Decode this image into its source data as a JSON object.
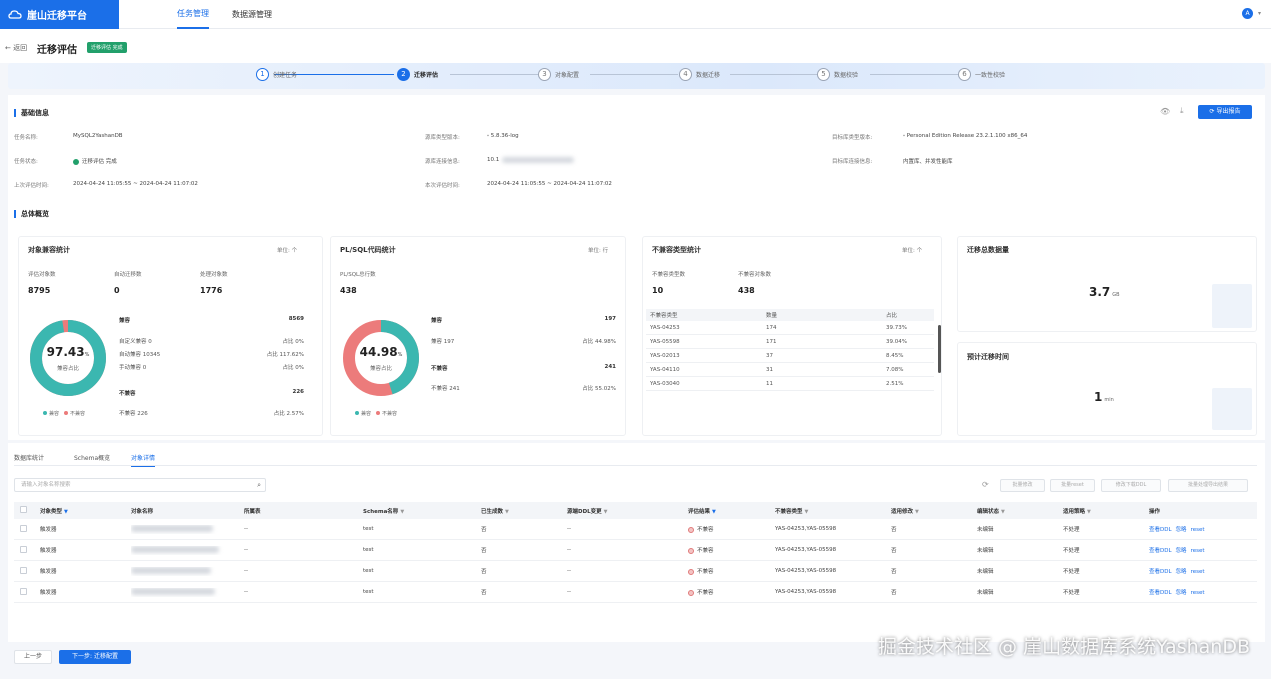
{
  "app": {
    "logo_text": "崖山迁移平台",
    "nav": [
      {
        "label": "任务管理",
        "active": true
      },
      {
        "label": "数据源管理",
        "active": false
      }
    ],
    "user_initial": "A"
  },
  "page": {
    "back_label": "← 返回",
    "title": "迁移评估",
    "badge": "迁移评估 完成"
  },
  "steps": [
    {
      "num": "1",
      "label": "创建任务"
    },
    {
      "num": "2",
      "label": "迁移评估"
    },
    {
      "num": "3",
      "label": "对象配置"
    },
    {
      "num": "4",
      "label": "数据迁移"
    },
    {
      "num": "5",
      "label": "数据校验"
    },
    {
      "num": "6",
      "label": "一致性校验"
    }
  ],
  "basic": {
    "section_title": "基础信息",
    "report_button": "导出报告",
    "task_name_label": "任务名称:",
    "task_name": "MySQL2YashanDB",
    "task_status_label": "任务状态:",
    "task_status": "迁移评估 完成",
    "last_eval_label": "上次评估时间:",
    "last_eval": "2024-04-24 11:05:55 ~ 2024-04-24 11:07:02",
    "src_version_label": "源库类型版本:",
    "src_version": "5.8.36-log",
    "src_conn_label": "源库连接信息:",
    "src_conn": "10.1",
    "this_eval_label": "本次评估时间:",
    "this_eval": "2024-04-24 11:05:55 ~ 2024-04-24 11:07:02",
    "tgt_version_label": "目标库类型版本:",
    "tgt_version": "Personal Edition Release 23.2.1.100 x86_64",
    "tgt_conn_label": "目标库连接信息:",
    "tgt_conn": "内置库、并发性能库"
  },
  "overview": {
    "section_title": "总体概览",
    "obj": {
      "title": "对象兼容统计",
      "unit": "单位: 个",
      "stats": [
        {
          "label": "评估对象数",
          "value": "8795"
        },
        {
          "label": "自动迁移数",
          "value": "0"
        },
        {
          "label": "处理对象数",
          "value": "1776"
        }
      ],
      "percent_int": "97.43",
      "percent_suffix": "%",
      "center_label": "兼容占比",
      "compat_label": "兼容",
      "compat_value": "8569",
      "rows": [
        {
          "l": "自定义兼容 0",
          "r": "占比 0%"
        },
        {
          "l": "自动兼容 10345",
          "r": "占比 117.62%"
        },
        {
          "l": "手动兼容 0",
          "r": "占比 0%"
        }
      ],
      "incompat_label": "不兼容",
      "incompat_value": "226",
      "incompat_row": {
        "l": "不兼容 226",
        "r": "占比 2.57%"
      },
      "legend": [
        "兼容",
        "不兼容"
      ],
      "ratio": 0.9743
    },
    "plsql": {
      "title": "PL/SQL代码统计",
      "unit": "单位: 行",
      "total_label": "PL/SQL总行数",
      "total_value": "438",
      "percent_int": "44.98",
      "percent_suffix": "%",
      "center_label": "兼容占比",
      "compat_label": "兼容",
      "compat_value": "197",
      "compat_row": {
        "l": "兼容 197",
        "r": "占比 44.98%"
      },
      "incompat_label": "不兼容",
      "incompat_value": "241",
      "incompat_row": {
        "l": "不兼容 241",
        "r": "占比 55.02%"
      },
      "legend": [
        "兼容",
        "不兼容"
      ],
      "ratio": 0.4498
    },
    "incompat": {
      "title": "不兼容类型统计",
      "unit": "单位: 个",
      "stats": [
        {
          "label": "不兼容类型数",
          "value": "10"
        },
        {
          "label": "不兼容对象数",
          "value": "438"
        }
      ],
      "headers": [
        "不兼容类型",
        "数量",
        "占比"
      ],
      "rows": [
        [
          "YAS-04253",
          "174",
          "39.73%"
        ],
        [
          "YAS-05598",
          "171",
          "39.04%"
        ],
        [
          "YAS-02013",
          "37",
          "8.45%"
        ],
        [
          "YAS-04110",
          "31",
          "7.08%"
        ],
        [
          "YAS-03040",
          "11",
          "2.51%"
        ]
      ]
    },
    "volume": {
      "title": "迁移总数据量",
      "value": "3.7",
      "unit": "GB"
    },
    "time": {
      "title": "预计迁移时间",
      "value": "1",
      "unit": "min"
    }
  },
  "tabs": [
    {
      "label": "数据库统计",
      "active": false
    },
    {
      "label": "Schema概览",
      "active": false
    },
    {
      "label": "对象详情",
      "active": true
    }
  ],
  "toolbar": {
    "search_placeholder": "请输入对象名称搜索",
    "buttons": [
      "批量修改",
      "批量reset",
      "修改下载DDL",
      "批量处理导出结果"
    ]
  },
  "table": {
    "headers": [
      "对象类型",
      "对象名称",
      "所属表",
      "Schema名称",
      "已生成数",
      "源端DDL变更",
      "评估结果",
      "不兼容类型",
      "适用修改",
      "编辑状态",
      "适用策略",
      "操作"
    ],
    "rows": [
      {
        "type": "触发器",
        "owner": "--",
        "schema": "test",
        "gen": "否",
        "ddl": "--",
        "result": "不兼容",
        "itype": "YAS-04253,YAS-05598",
        "fix": "否",
        "edit": "未编辑",
        "strategy": "不处理"
      },
      {
        "type": "触发器",
        "owner": "--",
        "schema": "test",
        "gen": "否",
        "ddl": "--",
        "result": "不兼容",
        "itype": "YAS-04253,YAS-05598",
        "fix": "否",
        "edit": "未编辑",
        "strategy": "不处理"
      },
      {
        "type": "触发器",
        "owner": "--",
        "schema": "test",
        "gen": "否",
        "ddl": "--",
        "result": "不兼容",
        "itype": "YAS-04253,YAS-05598",
        "fix": "否",
        "edit": "未编辑",
        "strategy": "不处理"
      },
      {
        "type": "触发器",
        "owner": "--",
        "schema": "test",
        "gen": "否",
        "ddl": "--",
        "result": "不兼容",
        "itype": "YAS-04253,YAS-05598",
        "fix": "否",
        "edit": "未编辑",
        "strategy": "不处理"
      }
    ],
    "actions": [
      "查看DDL",
      "忽略",
      "reset"
    ]
  },
  "footer": {
    "prev": "上一步",
    "next": "下一步: 迁移配置"
  },
  "watermark": "掘金技术社区 @ 崖山数据库系统YashanDB",
  "colors": {
    "brand": "#1b6fe8",
    "compat": "#3bb7b0",
    "incompat": "#ec7b7b",
    "success": "#22a06b"
  }
}
